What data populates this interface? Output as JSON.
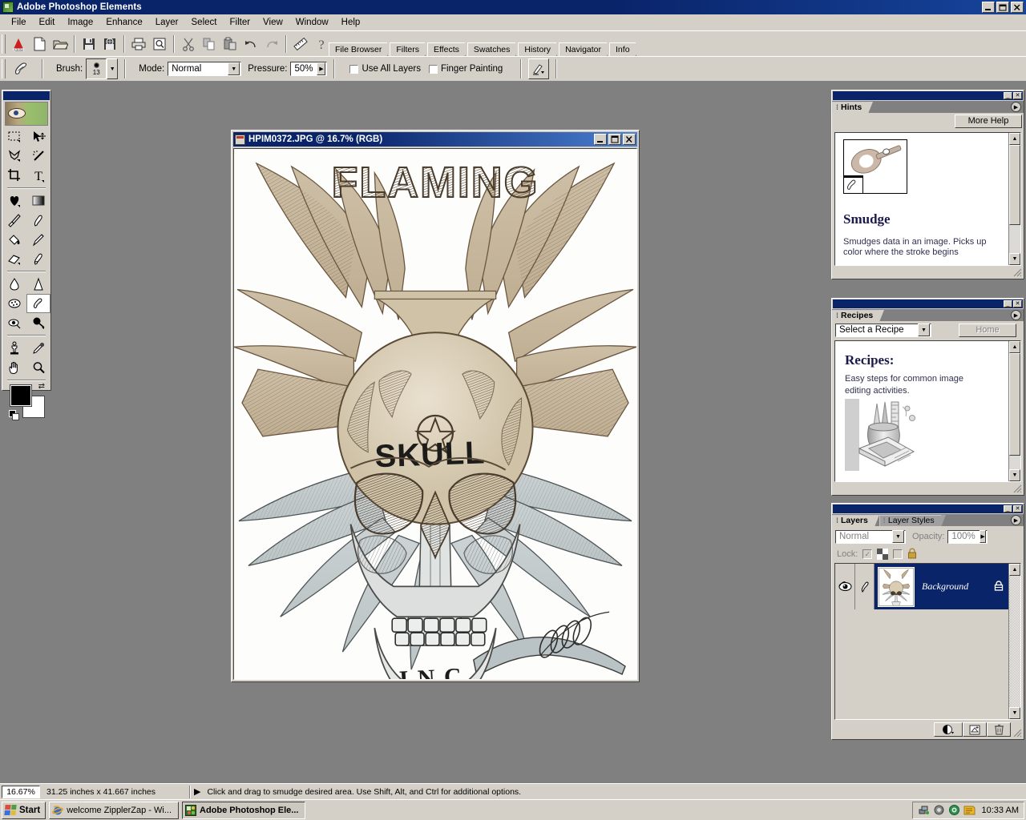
{
  "window": {
    "title": "Adobe Photoshop Elements",
    "app_icon": "photoshop-elements-icon",
    "minimize": "_",
    "maximize": "❐",
    "close": "✕"
  },
  "menubar": {
    "items": [
      "File",
      "Edit",
      "Image",
      "Enhance",
      "Layer",
      "Select",
      "Filter",
      "View",
      "Window",
      "Help"
    ]
  },
  "toolbar": {
    "buttons": [
      {
        "name": "adobe-logo-icon",
        "label": "Adobe"
      },
      {
        "name": "new-file-icon",
        "label": "New"
      },
      {
        "name": "open-folder-icon",
        "label": "Open"
      },
      {
        "name": "save-icon",
        "label": "Save"
      },
      {
        "name": "save-for-web-icon",
        "label": "Save For Web"
      },
      {
        "name": "print-icon",
        "label": "Print"
      },
      {
        "name": "print-preview-icon",
        "label": "Print Preview"
      },
      {
        "name": "cut-scissors-icon",
        "label": "Cut"
      },
      {
        "name": "copy-icon",
        "label": "Copy"
      },
      {
        "name": "paste-icon",
        "label": "Paste"
      },
      {
        "name": "undo-icon",
        "label": "Undo"
      },
      {
        "name": "redo-icon",
        "label": "Redo"
      },
      {
        "name": "measure-ruler-icon",
        "label": "Measure"
      },
      {
        "name": "help-question-icon",
        "label": "Help"
      }
    ]
  },
  "options_bar": {
    "tool_icon": "smudge-tool-icon",
    "brush_label": "Brush:",
    "brush_size": "13",
    "mode_label": "Mode:",
    "mode_value": "Normal",
    "pressure_label": "Pressure:",
    "pressure_value": "50%",
    "use_all_layers": "Use All Layers",
    "finger_painting": "Finger Painting",
    "more_options_icon": "brush-dynamics-icon"
  },
  "palette_well": {
    "tabs": [
      "File Browser",
      "Filters",
      "Effects",
      "Swatches",
      "History",
      "Navigator",
      "Info"
    ]
  },
  "toolbox": {
    "banner": "eye-recipe-banner",
    "tools": [
      {
        "name": "marquee-tool-icon",
        "label": "Rectangular Marquee"
      },
      {
        "name": "move-tool-icon",
        "label": "Move"
      },
      {
        "name": "lasso-tool-icon",
        "label": "Lasso"
      },
      {
        "name": "magic-wand-tool-icon",
        "label": "Magic Wand"
      },
      {
        "name": "crop-tool-icon",
        "label": "Crop"
      },
      {
        "name": "type-tool-icon",
        "label": "Type"
      },
      {
        "name": "shape-tool-icon",
        "label": "Custom Shape"
      },
      {
        "name": "gradient-tool-icon",
        "label": "Gradient"
      },
      {
        "name": "brush-tool-icon",
        "label": "Brush"
      },
      {
        "name": "pencil-paintbrush-icon",
        "label": "Paintbrush"
      },
      {
        "name": "paint-bucket-tool-icon",
        "label": "Paint Bucket"
      },
      {
        "name": "pencil-tool-icon",
        "label": "Pencil"
      },
      {
        "name": "eraser-tool-icon",
        "label": "Eraser"
      },
      {
        "name": "impressionist-brush-icon",
        "label": "Impressionist Brush"
      },
      {
        "name": "blur-tool-icon",
        "label": "Blur"
      },
      {
        "name": "sharpen-tool-icon",
        "label": "Sharpen"
      },
      {
        "name": "sponge-tool-icon",
        "label": "Sponge"
      },
      {
        "name": "smudge-tool-icon",
        "label": "Smudge",
        "selected": true
      },
      {
        "name": "red-eye-brush-icon",
        "label": "Red Eye Brush"
      },
      {
        "name": "dodge-burn-tool-icon",
        "label": "Dodge"
      },
      {
        "name": "clone-stamp-tool-icon",
        "label": "Clone Stamp"
      },
      {
        "name": "eyedropper-tool-icon",
        "label": "Eyedropper"
      },
      {
        "name": "hand-tool-icon",
        "label": "Hand"
      },
      {
        "name": "zoom-tool-icon",
        "label": "Zoom"
      }
    ],
    "foreground_color": "#000000",
    "background_color": "#ffffff",
    "swap_icon": "swap-colors-icon",
    "default_icon": "default-colors-icon"
  },
  "document": {
    "title": "HPIM0372.JPG @ 16.7% (RGB)",
    "icon": "image-document-icon",
    "minimize": "_",
    "maximize": "❐",
    "close": "✕",
    "artwork": {
      "top_text": "FLAMING",
      "skull_text": "SKULL",
      "bottom_text": "I.N.C.",
      "description": "Hand-drawn pen sketch of a winged flaming skull with a pentagram on the forehead"
    }
  },
  "hints_panel": {
    "tab": "Hints",
    "more_help_button": "More Help",
    "heading": "Smudge",
    "body": "Smudges data in an image. Picks up color where the stroke begins",
    "preview_icon": "smudge-key-preview"
  },
  "recipes_panel": {
    "tab": "Recipes",
    "select_value": "Select a Recipe",
    "home_button": "Home",
    "heading": "Recipes:",
    "body_line1": "Easy steps for common image",
    "body_line2": "editing activities.",
    "illustration": "pencil-cup-and-book-illustration"
  },
  "layers_panel": {
    "tabs": [
      "Layers",
      "Layer Styles"
    ],
    "active_tab": "Layers",
    "blend_mode": "Normal",
    "opacity_label": "Opacity:",
    "opacity_value": "100%",
    "lock_label": "Lock:",
    "lock_transparent_icon": "lock-transparency-icon",
    "lock_image_icon": "lock-image-icon",
    "lock_position_icon": "lock-position-icon",
    "lock_all_icon": "lock-all-icon",
    "layers": [
      {
        "name": "Background",
        "visible": true,
        "locked": true,
        "active": true,
        "eye_icon": "eye-visibility-icon",
        "brush_icon": "active-layer-brush-icon",
        "lock_icon": "layer-lock-icon"
      }
    ],
    "footer_buttons": [
      {
        "name": "new-adjustment-layer-icon",
        "label": "New Fill or Adjustment Layer"
      },
      {
        "name": "new-layer-icon",
        "label": "New Layer"
      },
      {
        "name": "delete-layer-trash-icon",
        "label": "Delete Layer"
      }
    ]
  },
  "statusbar": {
    "zoom": "16.67%",
    "dimensions": "31.25 inches x 41.667 inches",
    "arrow_icon": "status-menu-arrow-icon",
    "hint": "Click and drag to smudge desired area.  Use Shift, Alt, and Ctrl for additional options."
  },
  "taskbar": {
    "start_label": "Start",
    "start_icon": "windows-flag-icon",
    "items": [
      {
        "label": "welcome ZipplerZap - Wi...",
        "icon": "internet-explorer-icon",
        "active": false
      },
      {
        "label": "Adobe Photoshop Ele...",
        "icon": "photoshop-elements-icon",
        "active": true
      }
    ],
    "tray_icons": [
      "network-icon",
      "volume-icon",
      "shield-icon",
      "notes-icon"
    ],
    "clock": "10:33 AM"
  },
  "colors": {
    "face": "#d4d0c8",
    "titlebar": "#0a246a",
    "desktop": "#808080",
    "selection": "#0a246a",
    "highlight_text": "#ffffff"
  }
}
